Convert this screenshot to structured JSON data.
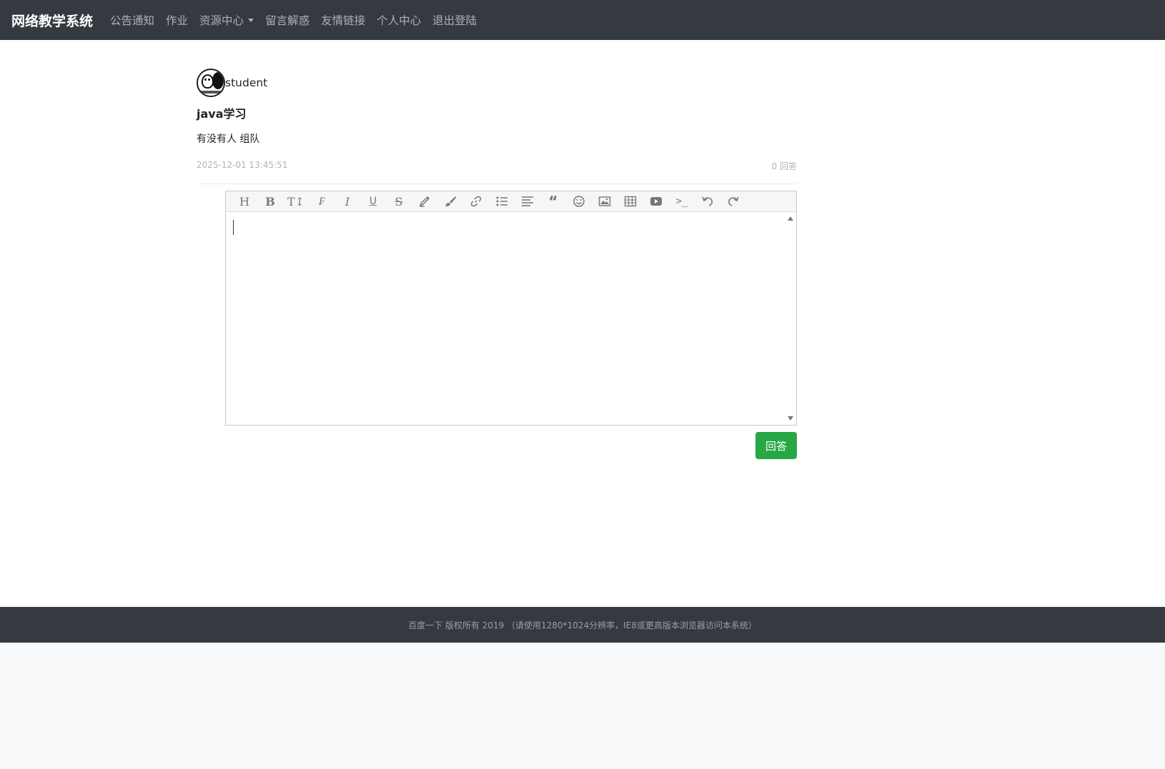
{
  "navbar": {
    "brand": "网络教学系统",
    "items": [
      {
        "label": "公告通知"
      },
      {
        "label": "作业"
      },
      {
        "label": "资源中心",
        "dropdown": true
      },
      {
        "label": "留言解惑"
      },
      {
        "label": "友情链接"
      },
      {
        "label": "个人中心"
      },
      {
        "label": "退出登陆"
      }
    ]
  },
  "post": {
    "author": "student",
    "title": "java学习",
    "body": "有没有人 组队",
    "timestamp": "2025-12-01 13:45:51",
    "answer_count": "0 回答"
  },
  "editor": {
    "toolbar_icons": [
      "heading-icon",
      "bold-icon",
      "font-size-icon",
      "font-family-icon",
      "italic-icon",
      "underline-icon",
      "strikethrough-icon",
      "foreground-color-icon",
      "background-color-icon",
      "link-icon",
      "list-icon",
      "align-icon",
      "quote-icon",
      "emoji-icon",
      "image-icon",
      "table-icon",
      "video-icon",
      "code-icon",
      "undo-icon",
      "redo-icon"
    ],
    "content": ""
  },
  "answer_button": "回答",
  "footer": {
    "text": "百度一下 版权所有 2019 （请使用1280*1024分辨率，IE8或更高版本浏览器访问本系统）"
  },
  "colors": {
    "navbar_bg": "#343a40",
    "button_green": "#28a745",
    "footer_bg": "#343a40"
  }
}
